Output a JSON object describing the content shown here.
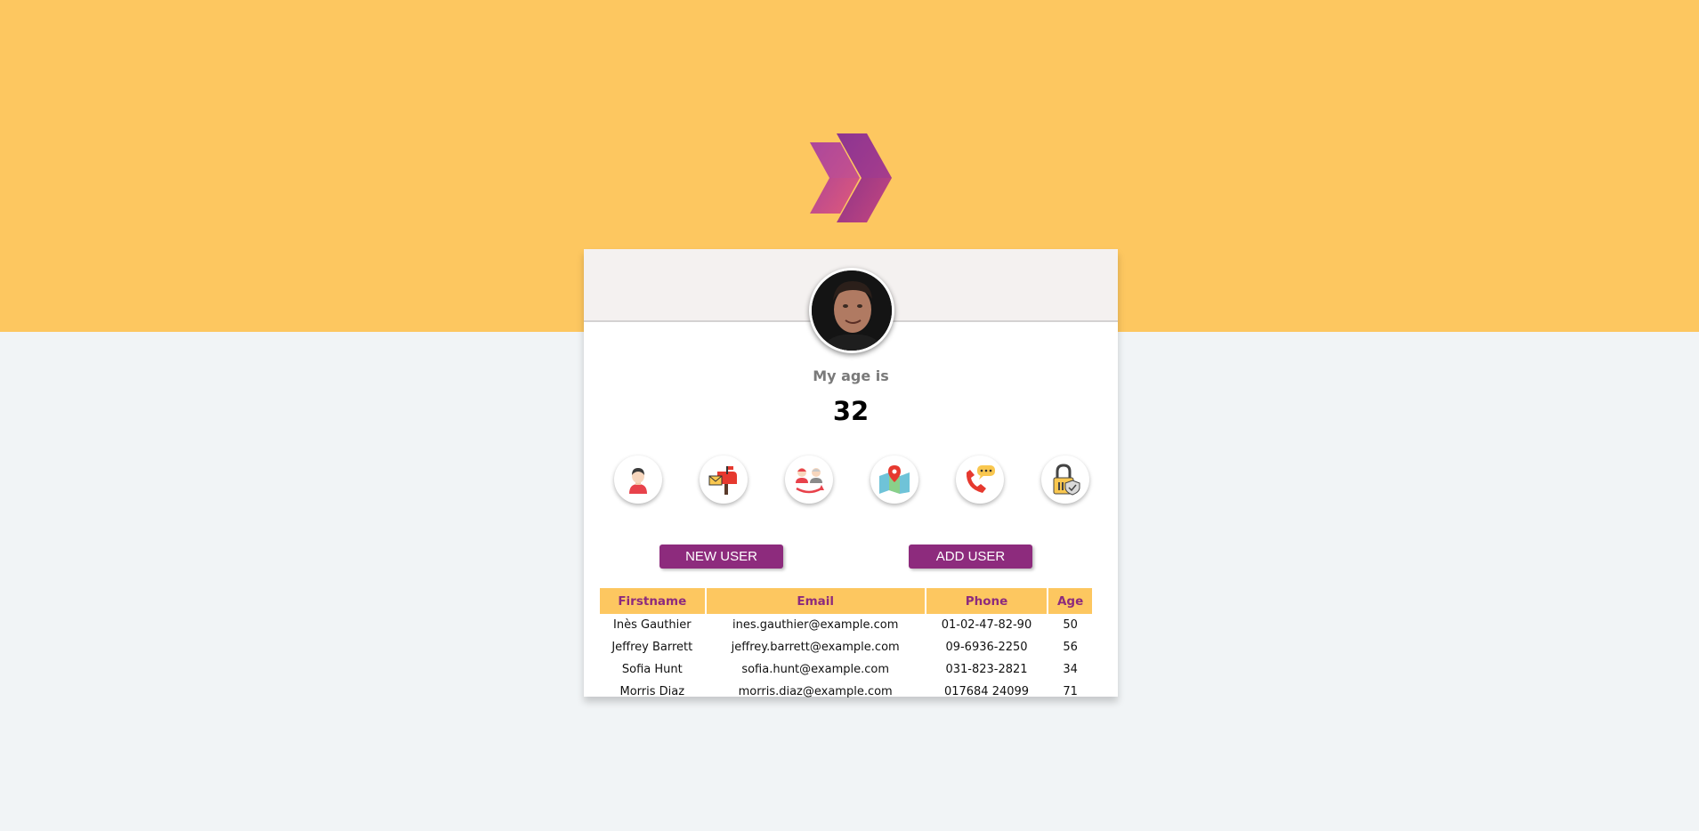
{
  "profile": {
    "title": "My age is",
    "value": "32"
  },
  "icons": [
    "user-icon",
    "mailbox-icon",
    "users-age-icon",
    "map-icon",
    "phone-icon",
    "lock-icon"
  ],
  "buttons": {
    "new_user": "NEW USER",
    "add_user": "ADD USER"
  },
  "table": {
    "headers": [
      "Firstname",
      "Email",
      "Phone",
      "Age"
    ],
    "rows": [
      [
        "Inès Gauthier",
        "ines.gauthier@example.com",
        "01-02-47-82-90",
        "50"
      ],
      [
        "Jeffrey Barrett",
        "jeffrey.barrett@example.com",
        "09-6936-2250",
        "56"
      ],
      [
        "Sofia Hunt",
        "sofia.hunt@example.com",
        "031-823-2821",
        "34"
      ],
      [
        "Morris Diaz",
        "morris.diaz@example.com",
        "017684 24099",
        "71"
      ]
    ]
  },
  "colors": {
    "band": "#fdc760",
    "accent": "#8d2b7d",
    "background": "#f1f4f6",
    "card": "#ffffff"
  }
}
